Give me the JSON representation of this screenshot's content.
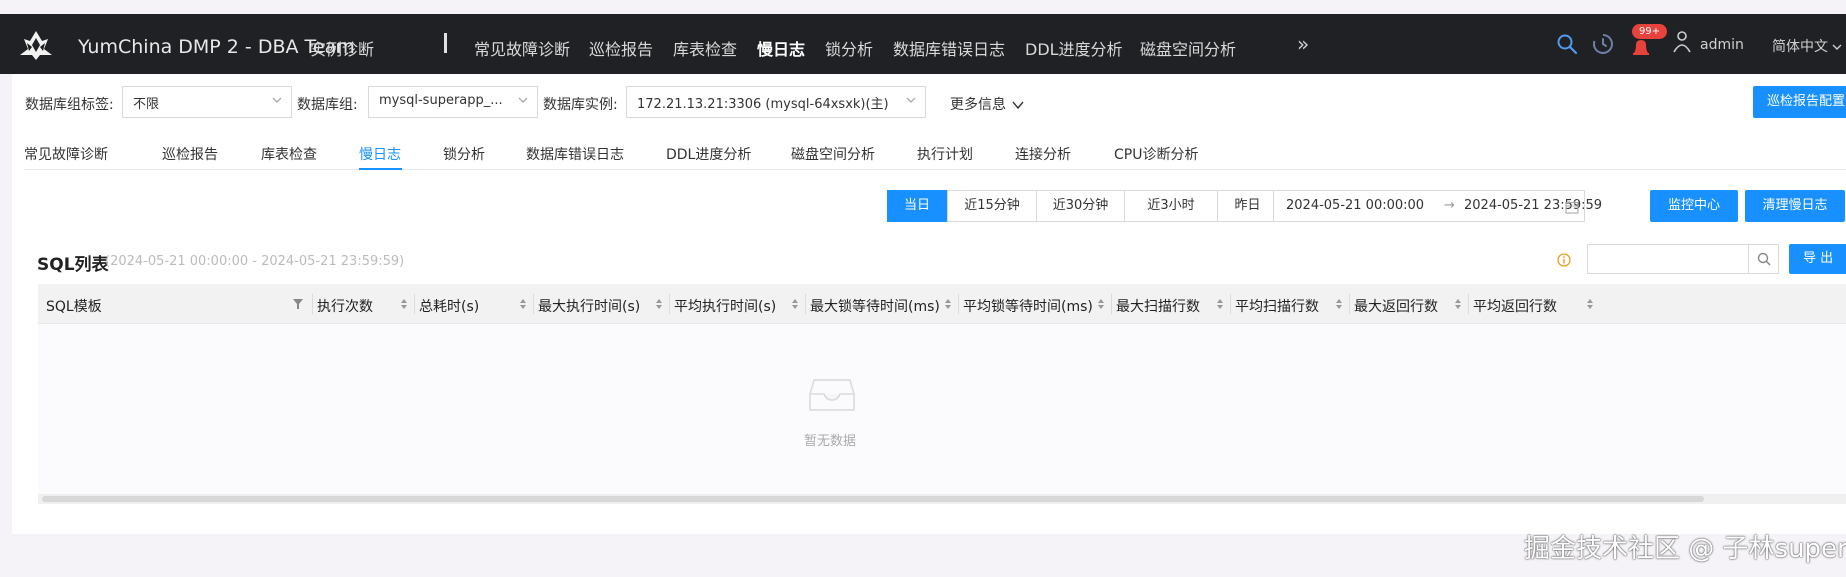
{
  "header": {
    "brand": "YumChina DMP 2 - DBA Team",
    "nav": [
      {
        "label": "实例诊断"
      },
      {
        "label": "常见故障诊断"
      },
      {
        "label": "巡检报告"
      },
      {
        "label": "库表检查"
      },
      {
        "label": "慢日志",
        "active": true
      },
      {
        "label": "锁分析"
      },
      {
        "label": "数据库错误日志"
      },
      {
        "label": "DDL进度分析"
      },
      {
        "label": "磁盘空间分析"
      }
    ],
    "more_glyph": "»",
    "notification_badge": "99+",
    "user": "admin",
    "language": "简体中文"
  },
  "filters": {
    "group_tag_label": "数据库组标签:",
    "group_tag_value": "不限",
    "db_group_label": "数据库组:",
    "db_group_value": "mysql-superapp_...",
    "instance_label": "数据库实例:",
    "instance_value": "172.21.13.21:3306 (mysql-64xsxk)(主)",
    "more_info": "更多信息",
    "inspection_config_button": "巡检报告配置"
  },
  "tabs": [
    {
      "label": "常见故障诊断"
    },
    {
      "label": "巡检报告"
    },
    {
      "label": "库表检查"
    },
    {
      "label": "慢日志",
      "active": true
    },
    {
      "label": "锁分析"
    },
    {
      "label": "数据库错误日志"
    },
    {
      "label": "DDL进度分析"
    },
    {
      "label": "磁盘空间分析"
    },
    {
      "label": "执行计划"
    },
    {
      "label": "连接分析"
    },
    {
      "label": "CPU诊断分析"
    }
  ],
  "time_range": {
    "options": [
      {
        "label": "当日",
        "active": true
      },
      {
        "label": "近15分钟"
      },
      {
        "label": "近30分钟"
      },
      {
        "label": "近3小时"
      },
      {
        "label": "昨日"
      }
    ],
    "start": "2024-05-21 00:00:00",
    "arrow": "→",
    "end": "2024-05-21 23:59:59",
    "monitor_button": "监控中心",
    "clear_button": "清理慢日志"
  },
  "sql_list": {
    "title": "SQL列表",
    "range": "(2024-05-21 00:00:00 - 2024-05-21 23:59:59)",
    "export_button": "导 出",
    "columns": [
      {
        "label": "SQL模板"
      },
      {
        "label": "执行次数"
      },
      {
        "label": "总耗时(s)"
      },
      {
        "label": "最大执行时间(s)"
      },
      {
        "label": "平均执行时间(s)"
      },
      {
        "label": "最大锁等待时间(ms)"
      },
      {
        "label": "平均锁等待时间(ms)"
      },
      {
        "label": "最大扫描行数"
      },
      {
        "label": "平均扫描行数"
      },
      {
        "label": "最大返回行数"
      },
      {
        "label": "平均返回行数"
      }
    ],
    "empty_text": "暂无数据"
  },
  "watermark": "掘金技术社区 @ 子林super",
  "colors": {
    "topbar": "#1f2124",
    "primary": "#1890ff",
    "badge": "#e8423c"
  }
}
